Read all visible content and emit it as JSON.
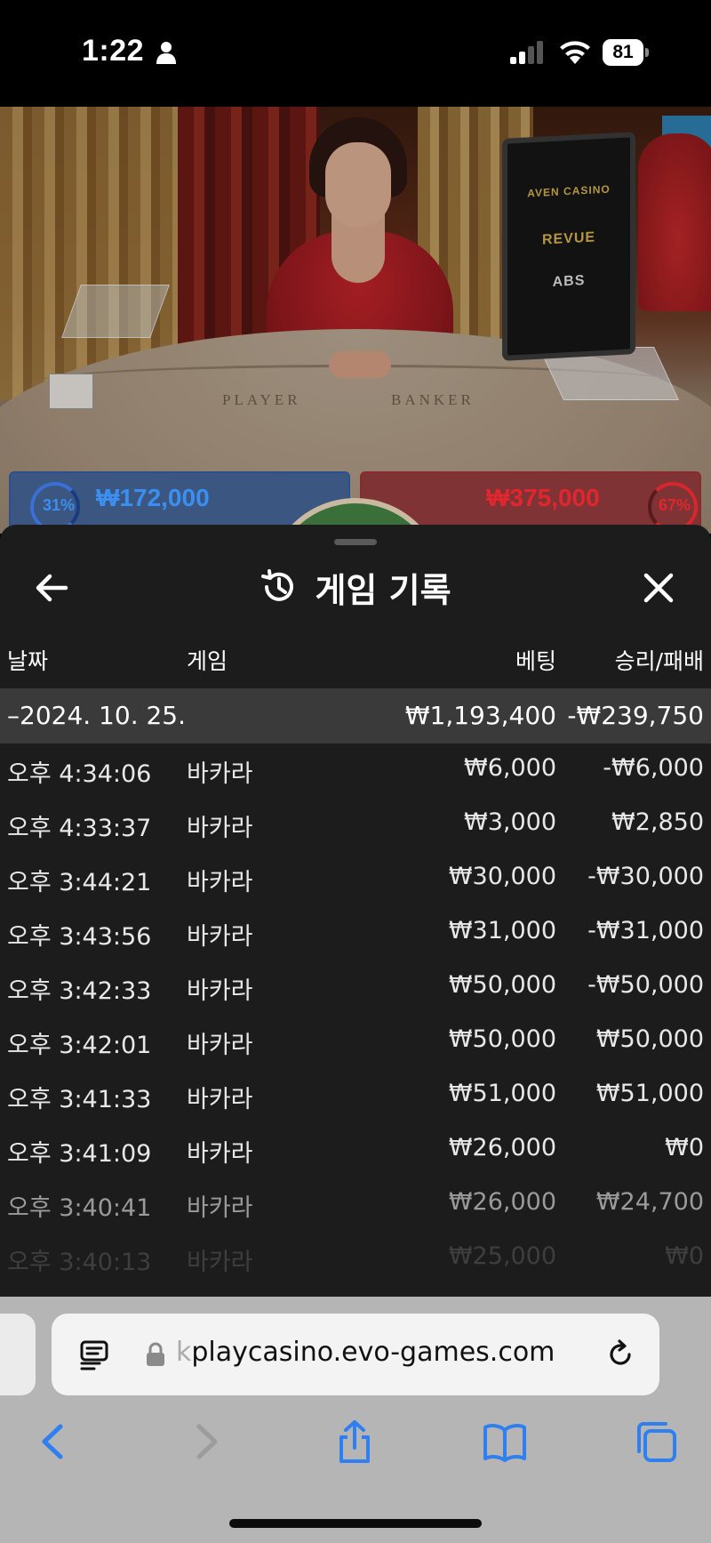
{
  "status_bar": {
    "time": "1:22",
    "battery": "81"
  },
  "video": {
    "table_left_label": "PLAYER",
    "table_right_label": "BANKER",
    "monitor_brands": [
      "AVEN CASINO",
      "REVUE",
      "ABS"
    ],
    "player_bet": {
      "amount": "₩172,000",
      "percent": "31%"
    },
    "banker_bet": {
      "amount": "₩375,000",
      "percent": "67%"
    }
  },
  "sheet": {
    "title": "게임 기록",
    "columns": {
      "date": "날짜",
      "game": "게임",
      "bet": "베팅",
      "result": "승리/패배"
    },
    "day": {
      "label": "–2024. 10. 25.",
      "total_bet": "₩1,193,400",
      "total_result": "-₩239,750"
    },
    "rows": [
      {
        "time": "오후 4:34:06",
        "game": "바카라",
        "bet": "₩6,000",
        "result": "-₩6,000"
      },
      {
        "time": "오후 4:33:37",
        "game": "바카라",
        "bet": "₩3,000",
        "result": "₩2,850"
      },
      {
        "time": "오후 3:44:21",
        "game": "바카라",
        "bet": "₩30,000",
        "result": "-₩30,000"
      },
      {
        "time": "오후 3:43:56",
        "game": "바카라",
        "bet": "₩31,000",
        "result": "-₩31,000"
      },
      {
        "time": "오후 3:42:33",
        "game": "바카라",
        "bet": "₩50,000",
        "result": "-₩50,000"
      },
      {
        "time": "오후 3:42:01",
        "game": "바카라",
        "bet": "₩50,000",
        "result": "₩50,000"
      },
      {
        "time": "오후 3:41:33",
        "game": "바카라",
        "bet": "₩51,000",
        "result": "₩51,000"
      },
      {
        "time": "오후 3:41:09",
        "game": "바카라",
        "bet": "₩26,000",
        "result": "₩0"
      },
      {
        "time": "오후 3:40:41",
        "game": "바카라",
        "bet": "₩26,000",
        "result": "₩24,700"
      },
      {
        "time": "오후 3:40:13",
        "game": "바카라",
        "bet": "₩25,000",
        "result": "₩0"
      }
    ]
  },
  "browser": {
    "url_prefix": "k",
    "url_main": "playcasino.evo-games.com"
  },
  "colors": {
    "sheet_bg": "#1c1c1c",
    "day_row_bg": "#3a3a3a",
    "safari_blue": "#2f7ff0"
  }
}
